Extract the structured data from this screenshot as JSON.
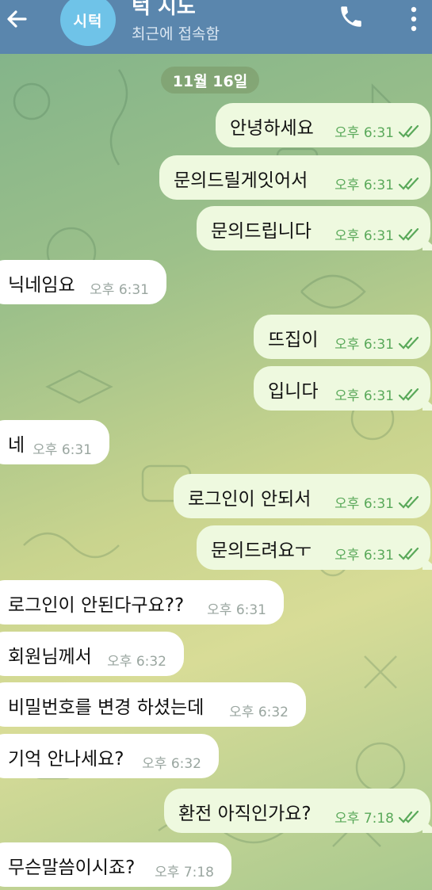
{
  "header": {
    "avatar_initials": "시턱",
    "chat_name": "턱 시도",
    "status": "최근에 접속함"
  },
  "date_chip": "11월 16일",
  "messages": [
    {
      "dir": "out",
      "text": "안녕하세요",
      "time": "오후 6:31",
      "read": true
    },
    {
      "dir": "out",
      "text": "문의드릴게잇어서",
      "time": "오후 6:31",
      "read": true
    },
    {
      "dir": "out",
      "text": "문의드립니다",
      "time": "오후 6:31",
      "read": true
    },
    {
      "dir": "in",
      "text": "닉네임요",
      "time": "오후 6:31"
    },
    {
      "dir": "out",
      "text": "뜨집이",
      "time": "오후 6:31",
      "read": true
    },
    {
      "dir": "out",
      "text": "입니다",
      "time": "오후 6:31",
      "read": true
    },
    {
      "dir": "in",
      "text": "네",
      "time": "오후 6:31"
    },
    {
      "dir": "out",
      "text": "로그인이 안되서",
      "time": "오후 6:31",
      "read": true
    },
    {
      "dir": "out",
      "text": "문의드려요ㅜ",
      "time": "오후 6:31",
      "read": true
    },
    {
      "dir": "in",
      "text": "로그인이 안된다구요??",
      "time": "오후 6:31"
    },
    {
      "dir": "in",
      "text": "회원님께서",
      "time": "오후 6:32"
    },
    {
      "dir": "in",
      "text": "비밀번호를 변경 하셨는데",
      "time": "오후 6:32"
    },
    {
      "dir": "in",
      "text": "기억 안나세요?",
      "time": "오후 6:32"
    },
    {
      "dir": "out",
      "text": "환전 아직인가요?",
      "time": "오후 7:18",
      "read": true
    },
    {
      "dir": "in",
      "text": "무슨말씀이시죠?",
      "time": "오후 7:18"
    }
  ],
  "colors": {
    "header_bg": "#5a86ad",
    "outgoing_bubble": "#eef9df",
    "incoming_bubble": "#ffffff",
    "read_check": "#5aa95a",
    "avatar_bg": "#6fc3e8"
  },
  "icons": {
    "back": "arrow-left-icon",
    "call": "phone-icon",
    "menu": "more-vertical-icon",
    "read": "double-check-icon"
  }
}
